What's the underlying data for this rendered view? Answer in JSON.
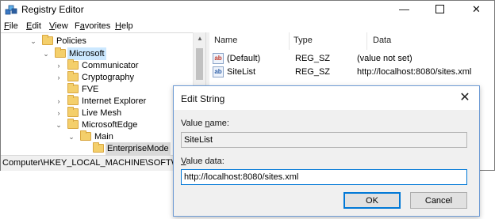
{
  "window": {
    "title": "Registry Editor",
    "minimize_glyph": "—",
    "close_glyph": "✕"
  },
  "menu": [
    {
      "label": "File",
      "accel": "F",
      "rest": "ile"
    },
    {
      "label": "Edit",
      "accel": "E",
      "rest": "dit"
    },
    {
      "label": "View",
      "accel": "V",
      "rest": "iew"
    },
    {
      "label": "Favorites",
      "accel": "a",
      "pre": "F",
      "rest": "vorites"
    },
    {
      "label": "Help",
      "accel": "H",
      "rest": "elp"
    }
  ],
  "tree": {
    "items": [
      {
        "label": "Policies",
        "state": "expanded"
      },
      {
        "label": "Microsoft",
        "state": "expanded",
        "selected": true
      },
      {
        "label": "Communicator",
        "state": "collapsed"
      },
      {
        "label": "Cryptography",
        "state": "collapsed"
      },
      {
        "label": "FVE",
        "state": "leaf"
      },
      {
        "label": "Internet Explorer",
        "state": "collapsed"
      },
      {
        "label": "Live Mesh",
        "state": "collapsed"
      },
      {
        "label": "MicrosoftEdge",
        "state": "expanded"
      },
      {
        "label": "Main",
        "state": "expanded"
      },
      {
        "label": "EnterpriseMode",
        "state": "leaf",
        "highlight": true
      }
    ],
    "chevron_expanded": "⌄",
    "chevron_collapsed": "›"
  },
  "status_path": "Computer\\HKEY_LOCAL_MACHINE\\SOFTWARE\\",
  "list": {
    "columns": [
      "Name",
      "Type",
      "Data"
    ],
    "rows": [
      {
        "icon": "string-value-icon",
        "badge": "ab",
        "name": "(Default)",
        "type": "REG_SZ",
        "data": "(value not set)"
      },
      {
        "icon": "string-value-icon",
        "badge": "ab",
        "name": "SiteList",
        "type": "REG_SZ",
        "data": "http://localhost:8080/sites.xml"
      }
    ]
  },
  "dialog": {
    "title": "Edit String",
    "close_glyph": "✕",
    "value_name_label": {
      "pre": "Value ",
      "accel": "n",
      "post": "ame:"
    },
    "value_name": "SiteList",
    "value_data_label": {
      "pre": "",
      "accel": "V",
      "post": "alue data:"
    },
    "value_data": "http://localhost:8080/sites.xml",
    "ok_label": "OK",
    "cancel_label": "Cancel"
  }
}
